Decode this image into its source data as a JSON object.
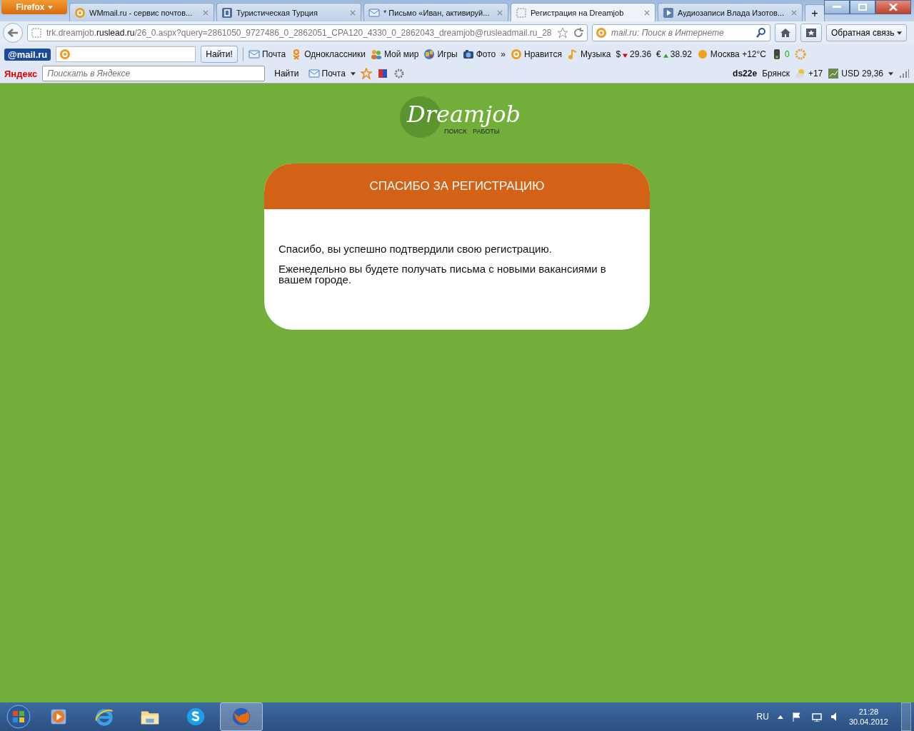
{
  "browser": {
    "menu_button": "Firefox",
    "tabs": [
      {
        "title": "WMmail.ru - сервис почтов...",
        "selected": false
      },
      {
        "title": "Туристическая Турция",
        "selected": false
      },
      {
        "title": "* Письмо «Иван, активируй...",
        "selected": false
      },
      {
        "title": "Регистрация на Dreamjob",
        "selected": true
      },
      {
        "title": "Аудиозаписи Влада Изотов...",
        "selected": false
      }
    ],
    "new_tab": "+",
    "url": {
      "prefix": "trk.dreamjob.",
      "domain": "ruslead.ru",
      "rest": "/26_0.aspx?query=2861050_9727486_0_2862051_CPA120_4330_0_2862043_dreamjob@rusleadmail.ru_28"
    },
    "search_placeholder": "mail.ru: Поиск в Интернете",
    "feedback_button": "Обратная связь"
  },
  "mail_toolbar": {
    "logo": "@mail.ru",
    "find_button": "Найти!",
    "items": [
      {
        "label": "Почта"
      },
      {
        "label": "Одноклассники"
      },
      {
        "label": "Мой мир"
      },
      {
        "label": "Игры"
      },
      {
        "label": "Фото"
      }
    ],
    "more": "»",
    "items_2": [
      {
        "label": "Нравится"
      },
      {
        "label": "Музыка"
      }
    ],
    "rates": [
      {
        "symbol": "$",
        "value": "29.36"
      },
      {
        "symbol": "€",
        "value": "38.92"
      }
    ],
    "weather": "Москва +12°C",
    "traffic": "0"
  },
  "yandex_toolbar": {
    "logo": "Яндекс",
    "search_placeholder": "Поискать в Яндексе",
    "find_button": "Найти",
    "mail": "Почта",
    "user": "ds22e",
    "city": "Брянск",
    "temperature": "+17",
    "currency": "USD 29,36"
  },
  "page": {
    "logo": "Dreamjob",
    "logo_left": "ПОИСК",
    "logo_right": "РАБОТЫ",
    "card": {
      "title": "СПАСИБО ЗА РЕГИСТРАЦИЮ",
      "paragraphs": [
        "Спасибо, вы успешно подтвердили свою регистрацию.",
        "Еженедельно вы будете получать письма с новыми вакансиями в вашем городе."
      ]
    }
  },
  "taskbar": {
    "apps": [
      {
        "kind": "player",
        "selected": false
      },
      {
        "kind": "browser-e",
        "selected": false
      },
      {
        "kind": "folder",
        "selected": false
      },
      {
        "kind": "chat",
        "selected": false
      },
      {
        "kind": "fox",
        "selected": true
      }
    ],
    "language": "RU",
    "time": "21:28",
    "date": "30.04.2012"
  }
}
